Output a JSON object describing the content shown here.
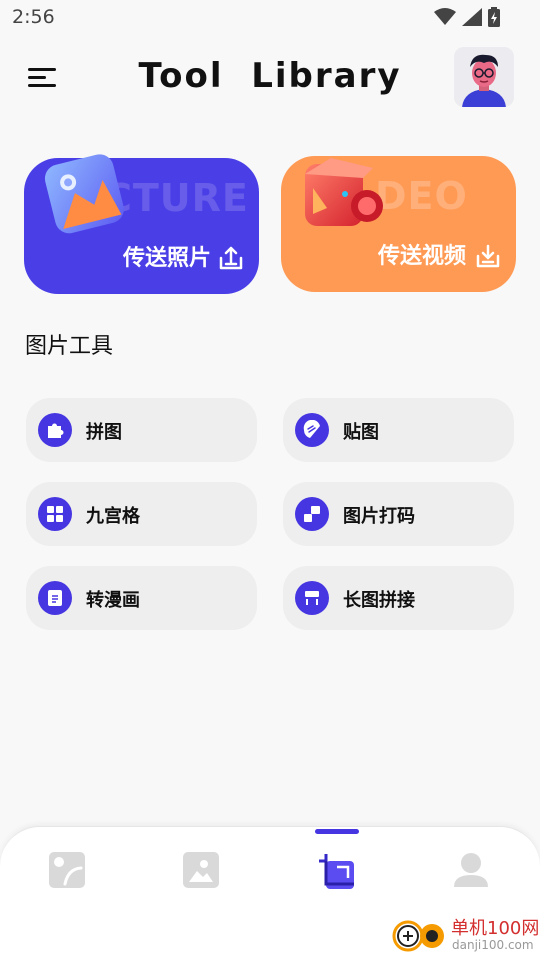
{
  "status_bar": {
    "time": "2:56",
    "icons": [
      "wifi-icon",
      "signal-icon",
      "battery-icon"
    ]
  },
  "app_bar": {
    "title": "Tool  Library",
    "menu_icon": "hamburger-menu-icon",
    "avatar_icon": "user-avatar"
  },
  "cards": {
    "photo": {
      "bg_text": "CTURE",
      "label": "传送照片",
      "icon": "upload-icon",
      "color": "#4a3fe6"
    },
    "video": {
      "bg_text": "DEO",
      "label": "传送视频",
      "icon": "download-icon",
      "color": "#ff9a55"
    }
  },
  "section": {
    "title": "图片工具"
  },
  "tools": [
    {
      "label": "拼图",
      "icon": "puzzle-icon"
    },
    {
      "label": "贴图",
      "icon": "sticker-icon"
    },
    {
      "label": "九宫格",
      "icon": "grid-icon"
    },
    {
      "label": "图片打码",
      "icon": "mosaic-icon"
    },
    {
      "label": "转漫画",
      "icon": "comic-icon"
    },
    {
      "label": "长图拼接",
      "icon": "long-image-icon"
    }
  ],
  "bottom_nav": {
    "items": [
      {
        "name": "transfer-tab",
        "icon": "transfer-icon",
        "active": false
      },
      {
        "name": "gallery-tab",
        "icon": "image-icon",
        "active": false
      },
      {
        "name": "tools-tab",
        "icon": "crop-icon",
        "active": true
      },
      {
        "name": "profile-tab",
        "icon": "person-icon",
        "active": false
      }
    ]
  },
  "watermark": {
    "text": "单机100网",
    "sub": "danji100.com"
  },
  "colors": {
    "accent": "#4636e2",
    "background": "#f8f8f8",
    "tool_bg": "#eeeeee"
  }
}
